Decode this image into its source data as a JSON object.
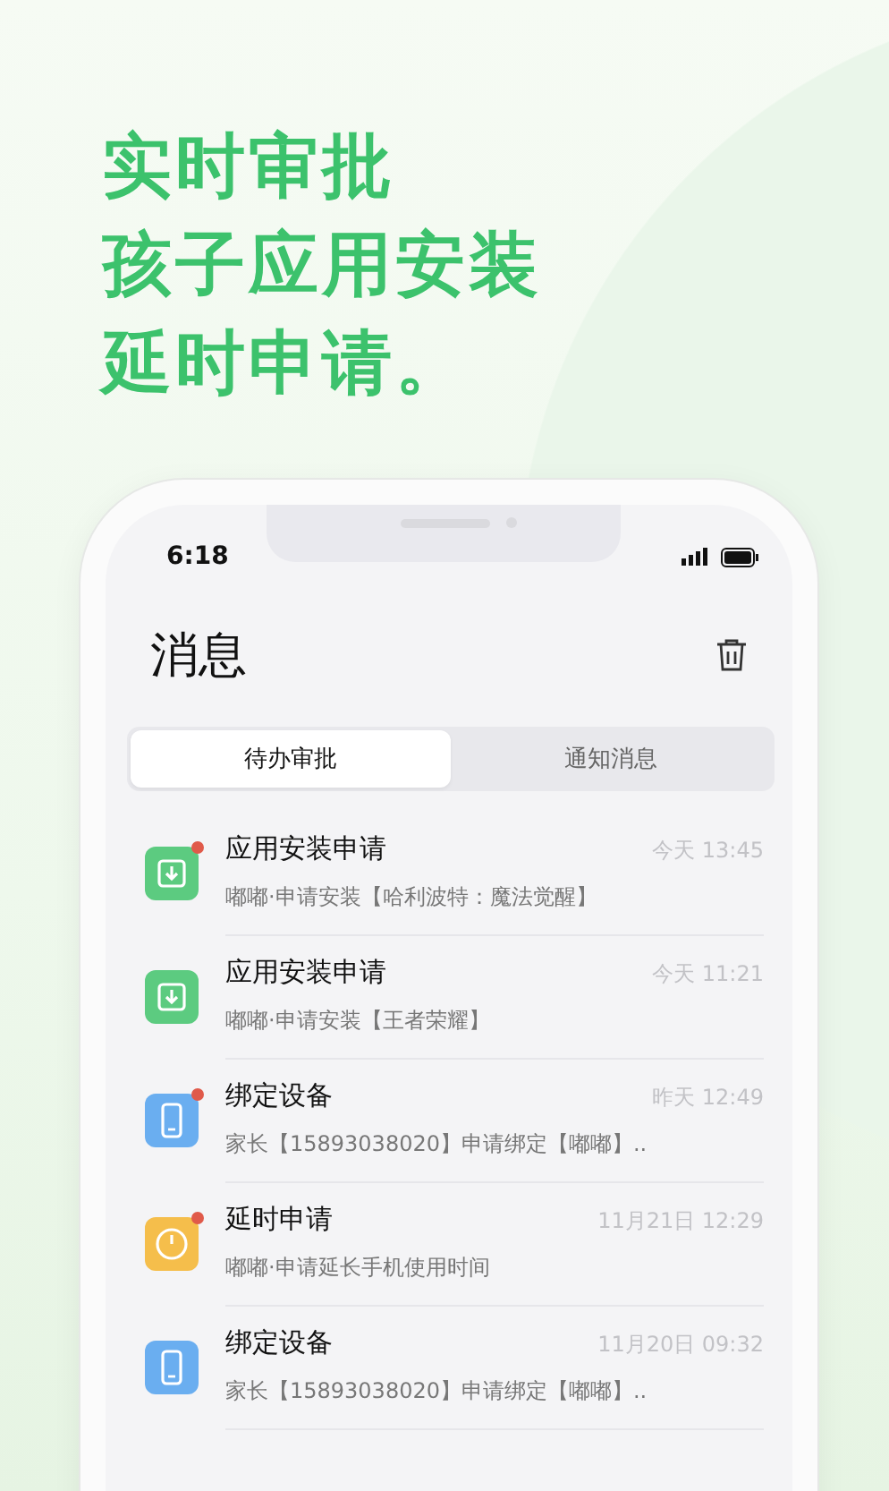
{
  "headline": [
    "实时审批",
    "孩子应用安装",
    "延时申请。"
  ],
  "status_bar": {
    "time": "6:18"
  },
  "header": {
    "title": "消息"
  },
  "tabs": [
    {
      "label": "待办审批",
      "selected": true
    },
    {
      "label": "通知消息",
      "selected": false
    }
  ],
  "messages": [
    {
      "kind": "install",
      "unread": true,
      "title": "应用安装申请",
      "time": "今天 13:45",
      "detail": "嘟嘟·申请安装【哈利波特：魔法觉醒】"
    },
    {
      "kind": "install",
      "unread": false,
      "title": "应用安装申请",
      "time": "今天 11:21",
      "detail": "嘟嘟·申请安装【王者荣耀】"
    },
    {
      "kind": "device",
      "unread": true,
      "title": "绑定设备",
      "time": "昨天 12:49",
      "detail": "家长【15893038020】申请绑定【嘟嘟】.."
    },
    {
      "kind": "timer",
      "unread": true,
      "title": "延时申请",
      "time": "11月21日 12:29",
      "detail": "嘟嘟·申请延长手机使用时间"
    },
    {
      "kind": "device",
      "unread": false,
      "title": "绑定设备",
      "time": "11月20日 09:32",
      "detail": "家长【15893038020】申请绑定【嘟嘟】.."
    }
  ]
}
